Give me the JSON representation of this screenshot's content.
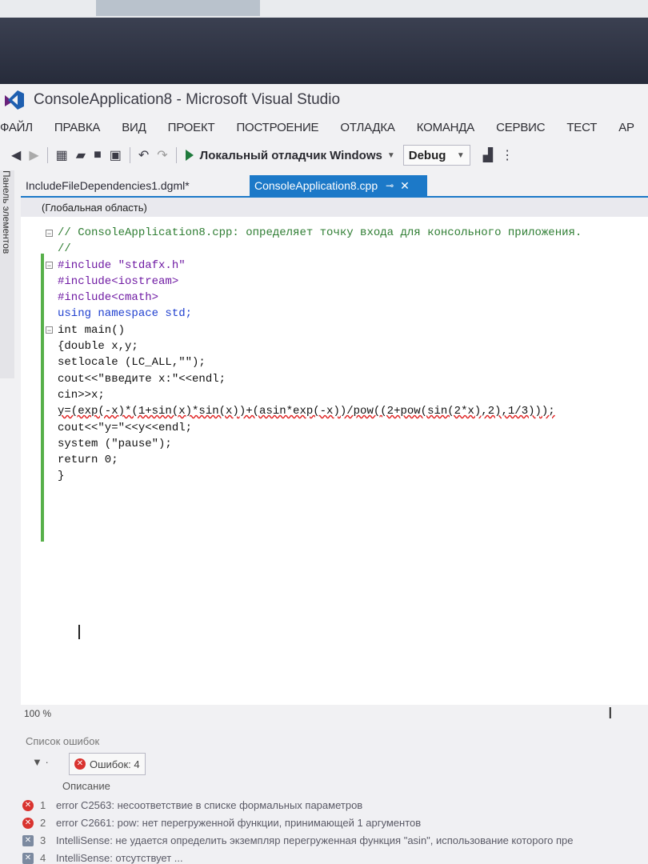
{
  "window": {
    "title": "ConsoleApplication8 - Microsoft Visual Studio"
  },
  "menu": [
    "ФАЙЛ",
    "ПРАВКА",
    "ВИД",
    "ПРОЕКТ",
    "ПОСТРОЕНИЕ",
    "ОТЛАДКА",
    "КОМАНДА",
    "СЕРВИС",
    "ТЕСТ",
    "АР"
  ],
  "toolbar": {
    "run_label": "Локальный отладчик Windows",
    "config": "Debug"
  },
  "side_panel": {
    "label": "Панель элементов"
  },
  "tabs": [
    {
      "label": "IncludeFileDependencies1.dgml*"
    },
    {
      "label": "ConsoleApplication8.cpp"
    }
  ],
  "scope": "(Глобальная область)",
  "code_lines": [
    "// ConsoleApplication8.cpp: определяет точку входа для консольного приложения.",
    "//",
    "#include \"stdafx.h\"",
    "#include<iostream>",
    "#include<cmath>",
    "using namespace std;",
    "int main()",
    "{double x,y;",
    "setlocale (LC_ALL,\"\");",
    "cout<<\"введите x:\"<<endl;",
    "cin>>x;",
    "y=(exp(-x)*(1+sin(x)*sin(x))+(asin*exp(-x))/pow((2+pow(sin(2*x),2),1/3)));",
    "cout<<\"y=\"<<y<<endl;",
    "system (\"pause\");",
    "return 0;",
    "}"
  ],
  "status": {
    "zoom": "100 %"
  },
  "error_list": {
    "title": "Список ошибок",
    "count_label": "Ошибок: 4",
    "column": "Описание",
    "rows": [
      {
        "num": "1",
        "kind": "error",
        "text": "error C2563: несоответствие в списке формальных параметров"
      },
      {
        "num": "2",
        "kind": "error",
        "text": "error C2661: pow: нет перегруженной функции, принимающей 1 аргументов"
      },
      {
        "num": "3",
        "kind": "intellisense",
        "text": "IntelliSense: не удается определить экземпляр перегруженная функция \"asin\", использование которого пре"
      },
      {
        "num": "4",
        "kind": "intellisense",
        "text": "IntelliSense: отсутствует ..."
      }
    ]
  },
  "colors": {
    "accent": "#1c79c8",
    "changebar": "#57b04a",
    "error": "#d9332f"
  }
}
